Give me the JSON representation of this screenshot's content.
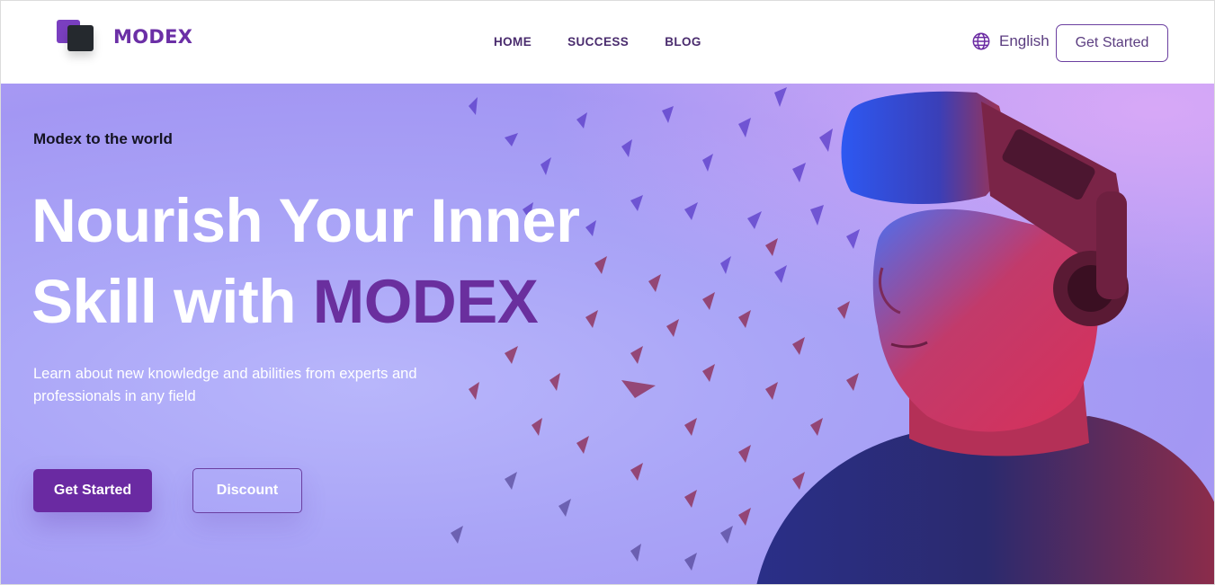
{
  "brand": {
    "name": "MODEX",
    "back_square_color": "#7a3fc0",
    "front_square_color": "#25292e"
  },
  "nav": {
    "items": [
      {
        "label": "HOME"
      },
      {
        "label": "SUCCESS"
      },
      {
        "label": "BLOG"
      }
    ]
  },
  "header": {
    "language": "English",
    "language_icon": "globe-icon",
    "cta_label": "Get Started"
  },
  "hero": {
    "eyebrow": "Modex to the world",
    "headline_line1": "Nourish Your Inner",
    "headline_line2_prefix": "Skill with ",
    "headline_brand": "MODEX",
    "subtitle": "Learn about new knowledge and abilities from experts and professionals in any field",
    "primary_button": "Get Started",
    "secondary_button": "Discount",
    "image_description_icon": "vr-headset-person-image"
  },
  "colors": {
    "accent": "#6a2aa2",
    "brand_text": "#6b2fa6",
    "hero_background": "#a9a4f6"
  }
}
